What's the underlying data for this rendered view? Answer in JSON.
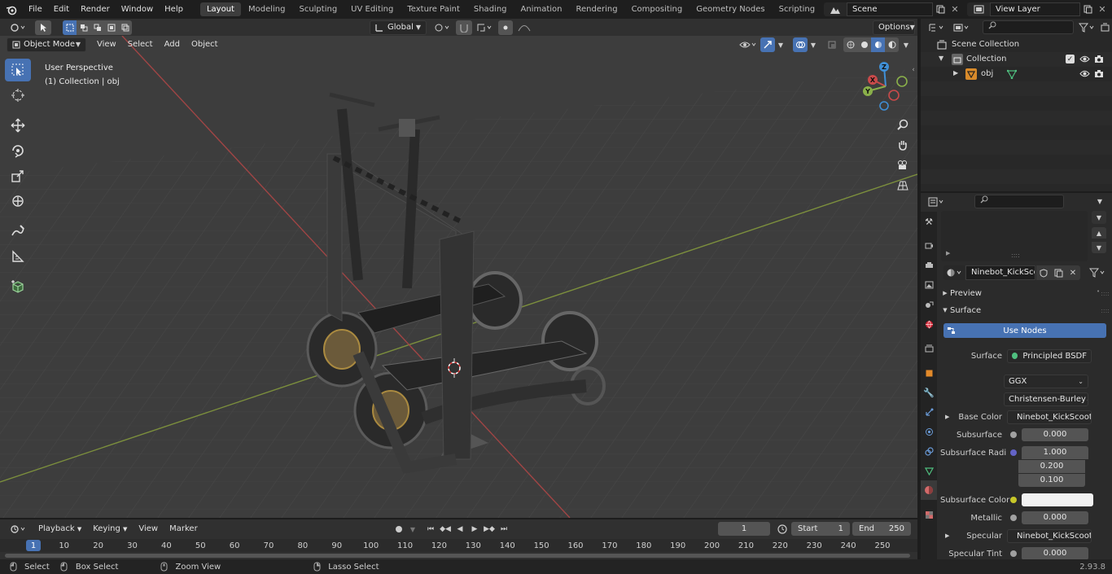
{
  "menus": [
    "File",
    "Edit",
    "Render",
    "Window",
    "Help"
  ],
  "workspaces": [
    "Layout",
    "Modeling",
    "Sculpting",
    "UV Editing",
    "Texture Paint",
    "Shading",
    "Animation",
    "Rendering",
    "Compositing",
    "Geometry Nodes",
    "Scripting"
  ],
  "active_workspace": "Layout",
  "scene": "Scene",
  "view_layer": "View Layer",
  "header": {
    "orientation": "Global",
    "options": "Options"
  },
  "viewport_menu": {
    "mode": "Object Mode",
    "items": [
      "View",
      "Select",
      "Add",
      "Object"
    ]
  },
  "overlay": {
    "view_name": "User Perspective",
    "collection": "(1) Collection | obj"
  },
  "gizmo": {
    "x": "X",
    "y": "Y",
    "z": "Z"
  },
  "outliner": {
    "root": "Scene Collection",
    "collection": "Collection",
    "object": "obj"
  },
  "material": {
    "name": "Ninebot_KickScoo..."
  },
  "panels": {
    "preview": "Preview",
    "surface": "Surface",
    "use_nodes": "Use Nodes"
  },
  "props": {
    "surface_label": "Surface",
    "surface_value": "Principled BSDF",
    "distribution": "GGX",
    "subsurface_method": "Christensen-Burley",
    "base_color_label": "Base Color",
    "base_color_value": "Ninebot_KickScooter...",
    "subsurface_label": "Subsurface",
    "subsurface_value": "0.000",
    "subsurface_radius_label": "Subsurface Radi...",
    "radius": [
      "1.000",
      "0.200",
      "0.100"
    ],
    "subsurface_color_label": "Subsurface Color",
    "metallic_label": "Metallic",
    "metallic_value": "0.000",
    "specular_label": "Specular",
    "specular_value": "Ninebot_KickScooter...",
    "specular_tint_label": "Specular Tint",
    "specular_tint_value": "0.000"
  },
  "timeline": {
    "menus": [
      "Playback",
      "Keying",
      "View",
      "Marker"
    ],
    "current_frame": "1",
    "start_label": "Start",
    "start": "1",
    "end_label": "End",
    "end": "250",
    "ticks": [
      "1",
      "10",
      "20",
      "30",
      "40",
      "50",
      "60",
      "70",
      "80",
      "90",
      "100",
      "110",
      "120",
      "130",
      "140",
      "150",
      "160",
      "170",
      "180",
      "190",
      "200",
      "210",
      "220",
      "230",
      "240",
      "250"
    ]
  },
  "status": {
    "select": "Select",
    "box_select": "Box Select",
    "zoom_view": "Zoom View",
    "lasso_select": "Lasso Select",
    "version": "2.93.8"
  },
  "colors": {
    "accent": "#4772b3",
    "x_axis": "#c94a4a",
    "y_axis": "#8ab04a",
    "z_axis": "#3f8fd6"
  }
}
